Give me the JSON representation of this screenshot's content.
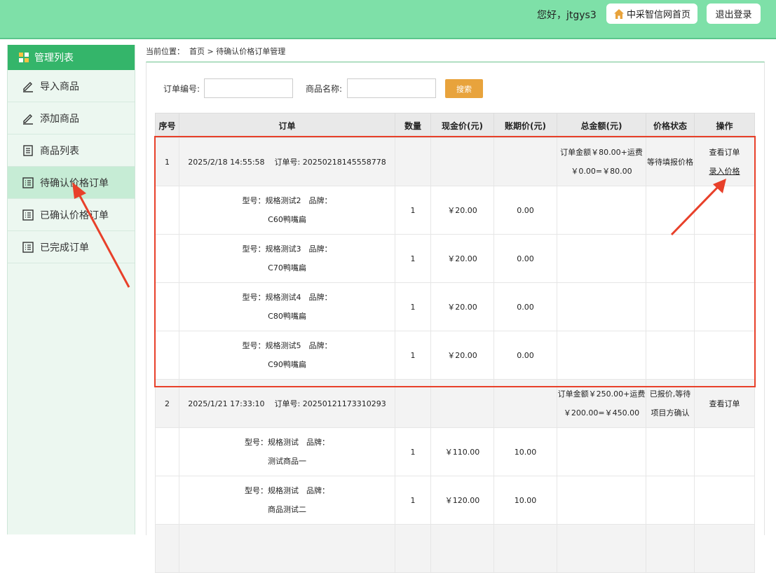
{
  "header": {
    "greeting": "您好，jtgys3",
    "home_button": "中采智信网首页",
    "logout_button": "退出登录"
  },
  "sidebar": {
    "title": "管理列表",
    "items": [
      {
        "label": "导入商品",
        "icon": "pencil-icon"
      },
      {
        "label": "添加商品",
        "icon": "pencil-icon"
      },
      {
        "label": "商品列表",
        "icon": "document-icon"
      },
      {
        "label": "待确认价格订单",
        "icon": "list-icon",
        "active": true
      },
      {
        "label": "已确认价格订单",
        "icon": "list-icon"
      },
      {
        "label": "已完成订单",
        "icon": "list-icon"
      }
    ]
  },
  "breadcrumb": {
    "prefix": "当前位置：",
    "home": "首页",
    "sep": ">",
    "current": "待确认价格订单管理"
  },
  "search": {
    "order_no_label": "订单编号:",
    "order_no_value": "",
    "product_name_label": "商品名称:",
    "product_name_value": "",
    "button": "搜索"
  },
  "table": {
    "headers": [
      "序号",
      "订单",
      "数量",
      "现金价(元)",
      "账期价(元)",
      "总金额(元)",
      "价格状态",
      "操作"
    ],
    "orders": [
      {
        "index": "1",
        "datetime": "2025/2/18 14:55:58",
        "order_no_label": "订单号:",
        "order_no": "20250218145558778",
        "total_line1": "订单金额￥80.00+运费",
        "total_line2": "￥0.00=￥80.00",
        "status_line1": "等待填报价格",
        "status_line2": "",
        "action1": "查看订单",
        "action2": "录入价格",
        "items": [
          {
            "line1": "型号：规格测试2　品牌：",
            "line2": "C60鸭嘴扁",
            "qty": "1",
            "cash": "￥20.00",
            "credit": "0.00"
          },
          {
            "line1": "型号：规格测试3　品牌：",
            "line2": "C70鸭嘴扁",
            "qty": "1",
            "cash": "￥20.00",
            "credit": "0.00"
          },
          {
            "line1": "型号：规格测试4　品牌：",
            "line2": "C80鸭嘴扁",
            "qty": "1",
            "cash": "￥20.00",
            "credit": "0.00"
          },
          {
            "line1": "型号：规格测试5　品牌：",
            "line2": "C90鸭嘴扁",
            "qty": "1",
            "cash": "￥20.00",
            "credit": "0.00"
          }
        ]
      },
      {
        "index": "2",
        "datetime": "2025/1/21 17:33:10",
        "order_no_label": "订单号:",
        "order_no": "20250121173310293",
        "total_line1": "订单金额￥250.00+运费",
        "total_line2": "￥200.00=￥450.00",
        "status_line1": "已报价,等待",
        "status_line2": "项目方确认",
        "action1": "查看订单",
        "action2": "",
        "items": [
          {
            "line1": "型号：规格测试　品牌：",
            "line2": "测试商品一",
            "qty": "1",
            "cash": "￥110.00",
            "credit": "10.00"
          },
          {
            "line1": "型号：规格测试　品牌：",
            "line2": "商品测试二",
            "qty": "1",
            "cash": "￥120.00",
            "credit": "10.00"
          }
        ]
      }
    ]
  },
  "colors": {
    "header_bg": "#7ee0a8",
    "sidebar_head": "#34b56a",
    "search_button": "#e8a33c",
    "annotation": "#e8402a"
  }
}
